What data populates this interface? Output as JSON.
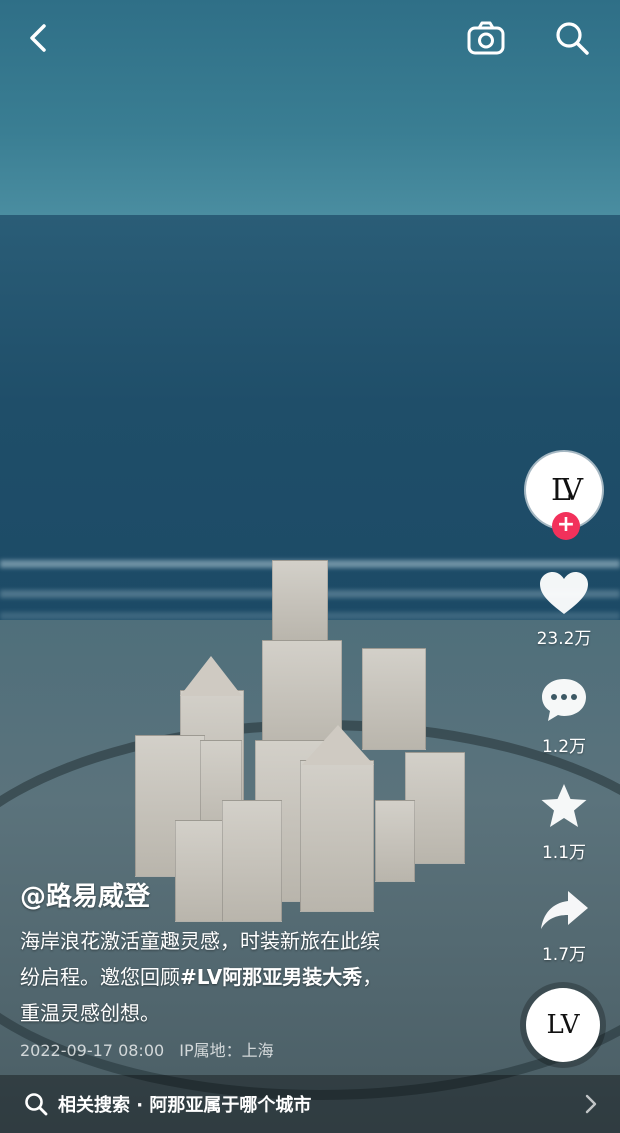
{
  "rail": {
    "avatar_text": "LV",
    "follow_symbol": "+",
    "likes": "23.2万",
    "comments": "1.2万",
    "favorites": "1.1万",
    "shares": "1.7万",
    "music_disc_text": "LV"
  },
  "post": {
    "author": "@路易威登",
    "caption_line1": "海岸浪花激活童趣灵感，时装新旅在此缤",
    "caption_line2_prefix": "纷启程。邀您回顾",
    "hashtag": "#LV阿那亚男装大秀",
    "caption_line2_suffix": "，",
    "caption_line3": "重温灵感创想。",
    "date": "2022-09-17 08:00",
    "ip_location": "IP属地：上海"
  },
  "related_search": {
    "label": "相关搜索 · 阿那亚属于哪个城市"
  },
  "icons": {
    "back": "back-arrow-icon",
    "camera": "camera-icon",
    "search": "search-icon",
    "like": "heart-icon",
    "comment": "comment-icon",
    "favorite": "star-icon",
    "share": "share-icon",
    "chevron": "chevron-right-icon"
  },
  "colors": {
    "follow_badge": "#f2315b",
    "text": "#ffffff"
  }
}
